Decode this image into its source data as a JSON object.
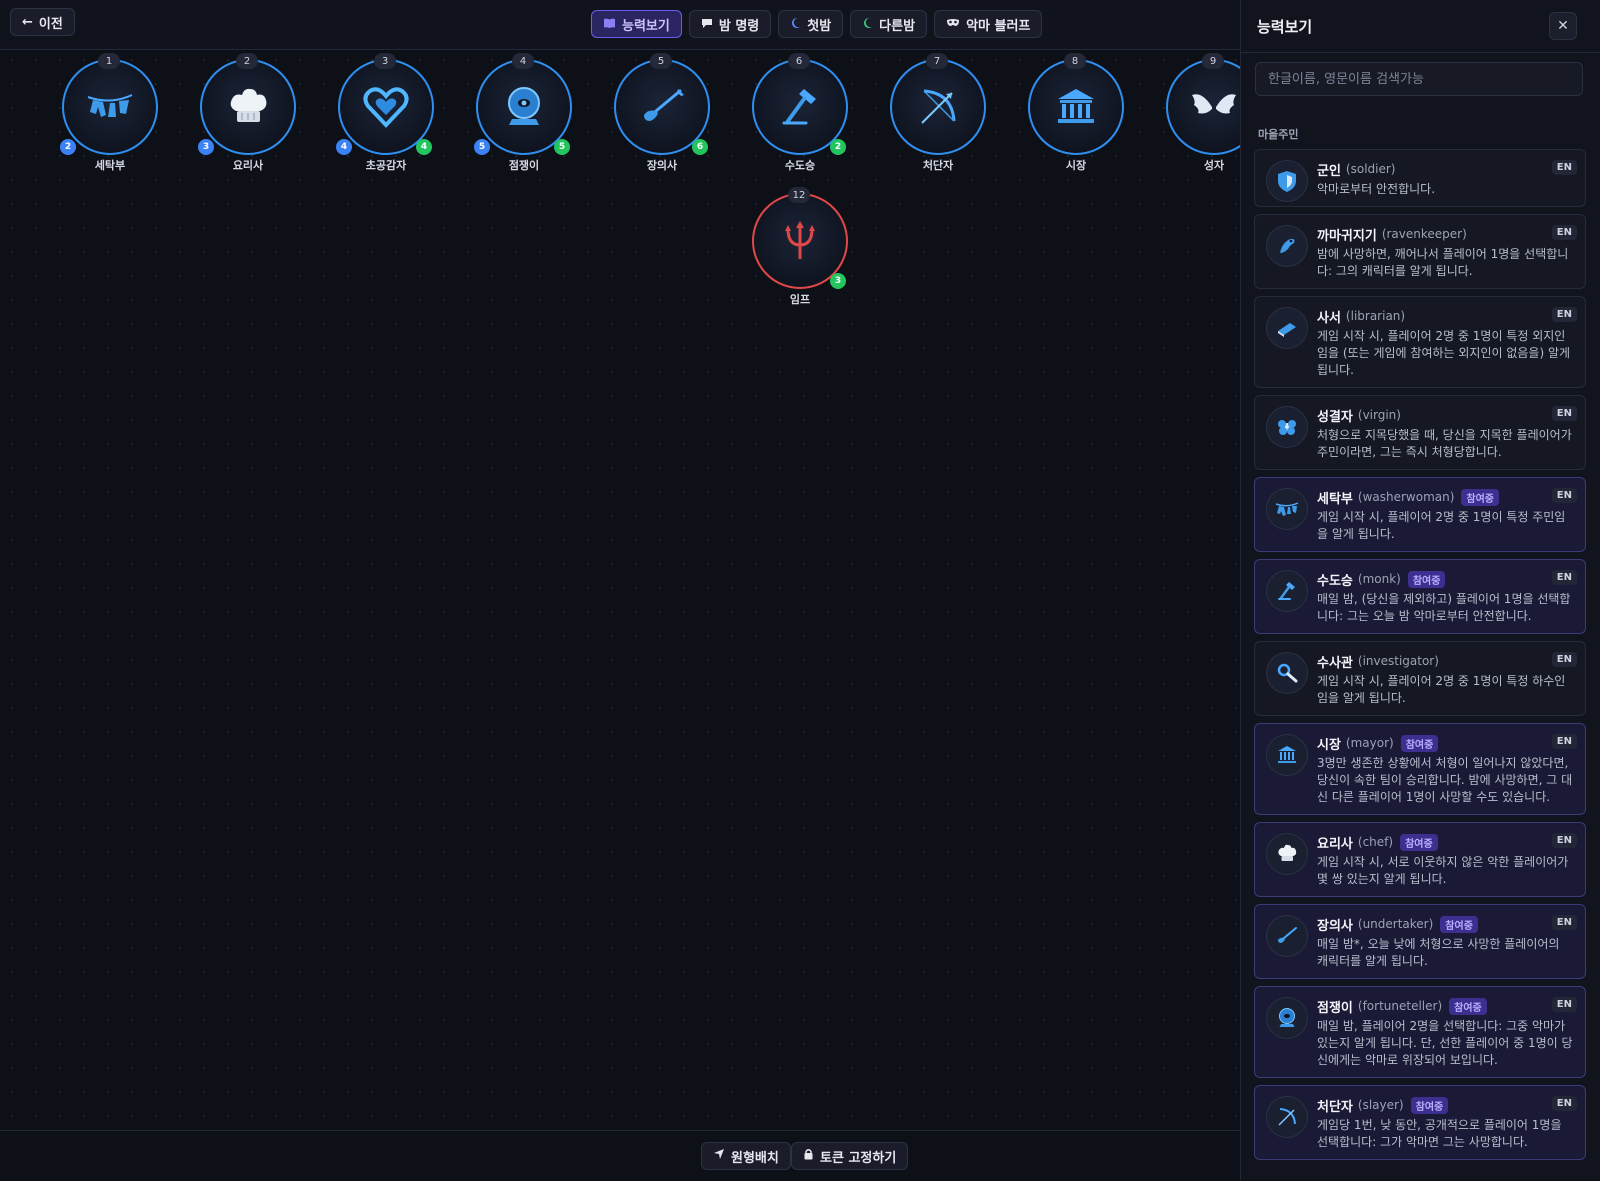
{
  "header": {
    "back_label": "이전",
    "tabs": [
      {
        "label": "능력보기",
        "icon": "book-icon",
        "active": true
      },
      {
        "label": "밤 명령",
        "icon": "speech-icon",
        "active": false
      },
      {
        "label": "첫밤",
        "icon": "moon-icon",
        "active": false
      },
      {
        "label": "다른밤",
        "icon": "moon-icon",
        "active": false
      },
      {
        "label": "악마 블러프",
        "icon": "mask-icon",
        "active": false
      }
    ]
  },
  "tokens": [
    {
      "seat": "1",
      "name": "세탁부",
      "icon": "laundry-icon",
      "blue": "2",
      "green": null,
      "team": "good"
    },
    {
      "seat": "2",
      "name": "요리사",
      "icon": "chef-hat-icon",
      "blue": "3",
      "green": null,
      "team": "good"
    },
    {
      "seat": "3",
      "name": "초공감자",
      "icon": "heart-icon",
      "blue": "4",
      "green": "4",
      "team": "good"
    },
    {
      "seat": "4",
      "name": "점쟁이",
      "icon": "crystal-ball-icon",
      "blue": "5",
      "green": "5",
      "team": "good"
    },
    {
      "seat": "5",
      "name": "장의사",
      "icon": "shovel-icon",
      "blue": null,
      "green": "6",
      "team": "good"
    },
    {
      "seat": "6",
      "name": "수도승",
      "icon": "hammer-icon",
      "blue": null,
      "green": "2",
      "team": "good"
    },
    {
      "seat": "7",
      "name": "처단자",
      "icon": "bow-icon",
      "blue": null,
      "green": null,
      "team": "good"
    },
    {
      "seat": "8",
      "name": "시장",
      "icon": "town-hall-icon",
      "blue": null,
      "green": null,
      "team": "good"
    },
    {
      "seat": "9",
      "name": "성자",
      "icon": "wings-icon",
      "blue": null,
      "green": null,
      "team": "good"
    },
    {
      "seat": "12",
      "name": "임프",
      "icon": "trident-icon",
      "blue": null,
      "green": "3",
      "team": "evil"
    }
  ],
  "footer": {
    "arrange_label": "원형배치",
    "lock_label": "토큰 고정하기"
  },
  "panel": {
    "title": "능력보기",
    "close_label": "✕",
    "search_placeholder": "한글이름, 영문이름 검색가능",
    "section_label": "마을주민",
    "en_label": "EN",
    "joined_label": "참여중",
    "cards": [
      {
        "name": "군인",
        "en": "(soldier)",
        "icon": "shield-icon",
        "joined": false,
        "desc": "악마로부터 안전합니다."
      },
      {
        "name": "까마귀지기",
        "en": "(ravenkeeper)",
        "icon": "raven-icon",
        "joined": false,
        "desc": "밤에 사망하면, 깨어나서 플레이어 1명을 선택합니다: 그의 캐릭터를 알게 됩니다."
      },
      {
        "name": "사서",
        "en": "(librarian)",
        "icon": "book-icon",
        "joined": false,
        "desc": "게임 시작 시, 플레이어 2명 중 1명이 특정 외지인임을 (또는 게임에 참여하는 외지인이 없음을) 알게 됩니다."
      },
      {
        "name": "성결자",
        "en": "(virgin)",
        "icon": "flower-icon",
        "joined": false,
        "desc": "처형으로 지목당했을 때, 당신을 지목한 플레이어가 주민이라면, 그는 즉시 처형당합니다."
      },
      {
        "name": "세탁부",
        "en": "(washerwoman)",
        "icon": "laundry-icon",
        "joined": true,
        "desc": "게임 시작 시, 플레이어 2명 중 1명이 특정 주민임을 알게 됩니다."
      },
      {
        "name": "수도승",
        "en": "(monk)",
        "icon": "hammer-icon",
        "joined": true,
        "desc": "매일 밤, (당신을 제외하고) 플레이어 1명을 선택합니다: 그는 오늘 밤 악마로부터 안전합니다."
      },
      {
        "name": "수사관",
        "en": "(investigator)",
        "icon": "magnifier-icon",
        "joined": false,
        "desc": "게임 시작 시, 플레이어 2명 중 1명이 특정 하수인임을 알게 됩니다."
      },
      {
        "name": "시장",
        "en": "(mayor)",
        "icon": "town-hall-icon",
        "joined": true,
        "desc": "3명만 생존한 상황에서 처형이 일어나지 않았다면, 당신이 속한 팀이 승리합니다. 밤에 사망하면, 그 대신 다른 플레이어 1명이 사망할 수도 있습니다."
      },
      {
        "name": "요리사",
        "en": "(chef)",
        "icon": "chef-hat-icon",
        "joined": true,
        "desc": "게임 시작 시, 서로 이웃하지 않은 악한 플레이어가 몇 쌍 있는지 알게 됩니다."
      },
      {
        "name": "장의사",
        "en": "(undertaker)",
        "icon": "shovel-icon",
        "joined": true,
        "desc": "매일 밤*, 오늘 낮에 처형으로 사망한 플레이어의 캐릭터를 알게 됩니다."
      },
      {
        "name": "점쟁이",
        "en": "(fortuneteller)",
        "icon": "crystal-ball-icon",
        "joined": true,
        "desc": "매일 밤, 플레이어 2명을 선택합니다: 그중 악마가 있는지 알게 됩니다. 단, 선한 플레이어 중 1명이 당신에게는 악마로 위장되어 보입니다."
      },
      {
        "name": "처단자",
        "en": "(slayer)",
        "icon": "bow-icon",
        "joined": true,
        "desc": "게임당 1번, 낮 동안, 공개적으로 플레이어 1명을 선택합니다: 그가 악마면 그는 사망합니다."
      }
    ]
  }
}
